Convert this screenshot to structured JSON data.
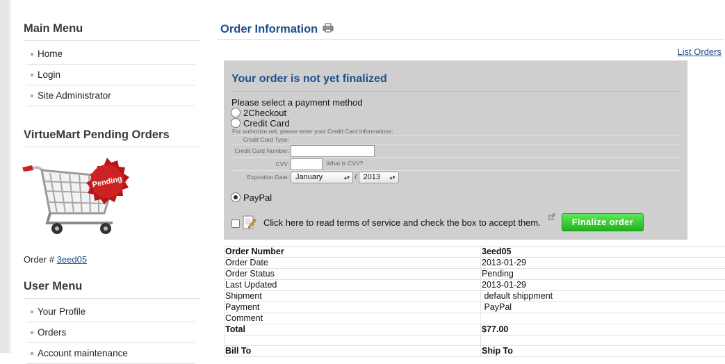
{
  "sidebar": {
    "main_menu": {
      "title": "Main Menu",
      "items": [
        "Home",
        "Login",
        "Site Administrator"
      ]
    },
    "pending": {
      "title": "VirtueMart Pending Orders",
      "badge_text": "Pending",
      "order_label": "Order #",
      "order_link": "3eed05"
    },
    "user_menu": {
      "title": "User Menu",
      "items": [
        "Your Profile",
        "Orders",
        "Account maintenance"
      ]
    }
  },
  "main": {
    "title": "Order Information",
    "list_orders": "List Orders",
    "payment_box": {
      "title": "Your order is not yet finalized",
      "prompt": "Please select a payment method",
      "methods": [
        "2Checkout",
        "Credit Card",
        "PayPal"
      ],
      "selected_method": "PayPal",
      "cc_note": "For authorize.net, please enter your Credit Card informations:",
      "cc_type_label": "Credit Card Type:",
      "cc_number_label": "Credit Card Number:",
      "cvv_label": "CVV:",
      "cvv_help": "What is CVV?",
      "expiration_label": "Expiration Date:",
      "month_value": "January",
      "year_value": "2013",
      "slash": "/",
      "terms_text": "Click here to read terms of service and check the box to accept them.",
      "finalize_button": "Finalize order"
    },
    "order_table": [
      {
        "label": "Order Number",
        "value": "3eed05",
        "bold": true
      },
      {
        "label": "Order Date",
        "value": "2013-01-29",
        "bold": false
      },
      {
        "label": "Order Status",
        "value": "Pending",
        "bold": false
      },
      {
        "label": "Last Updated",
        "value": "2013-01-29",
        "bold": false
      },
      {
        "label": "Shipment",
        "value": " default shippment",
        "bold": false
      },
      {
        "label": "Payment",
        "value": " PayPal",
        "bold": false
      },
      {
        "label": "Comment",
        "value": "",
        "bold": false
      },
      {
        "label": "Total",
        "value": "$77.00",
        "bold": true
      }
    ],
    "bill_to": "Bill To",
    "ship_to": "Ship To"
  },
  "colors": {
    "title_blue": "#1f4e8c",
    "box_gray": "#cfcfcf",
    "button_green": "#2fc22b"
  }
}
